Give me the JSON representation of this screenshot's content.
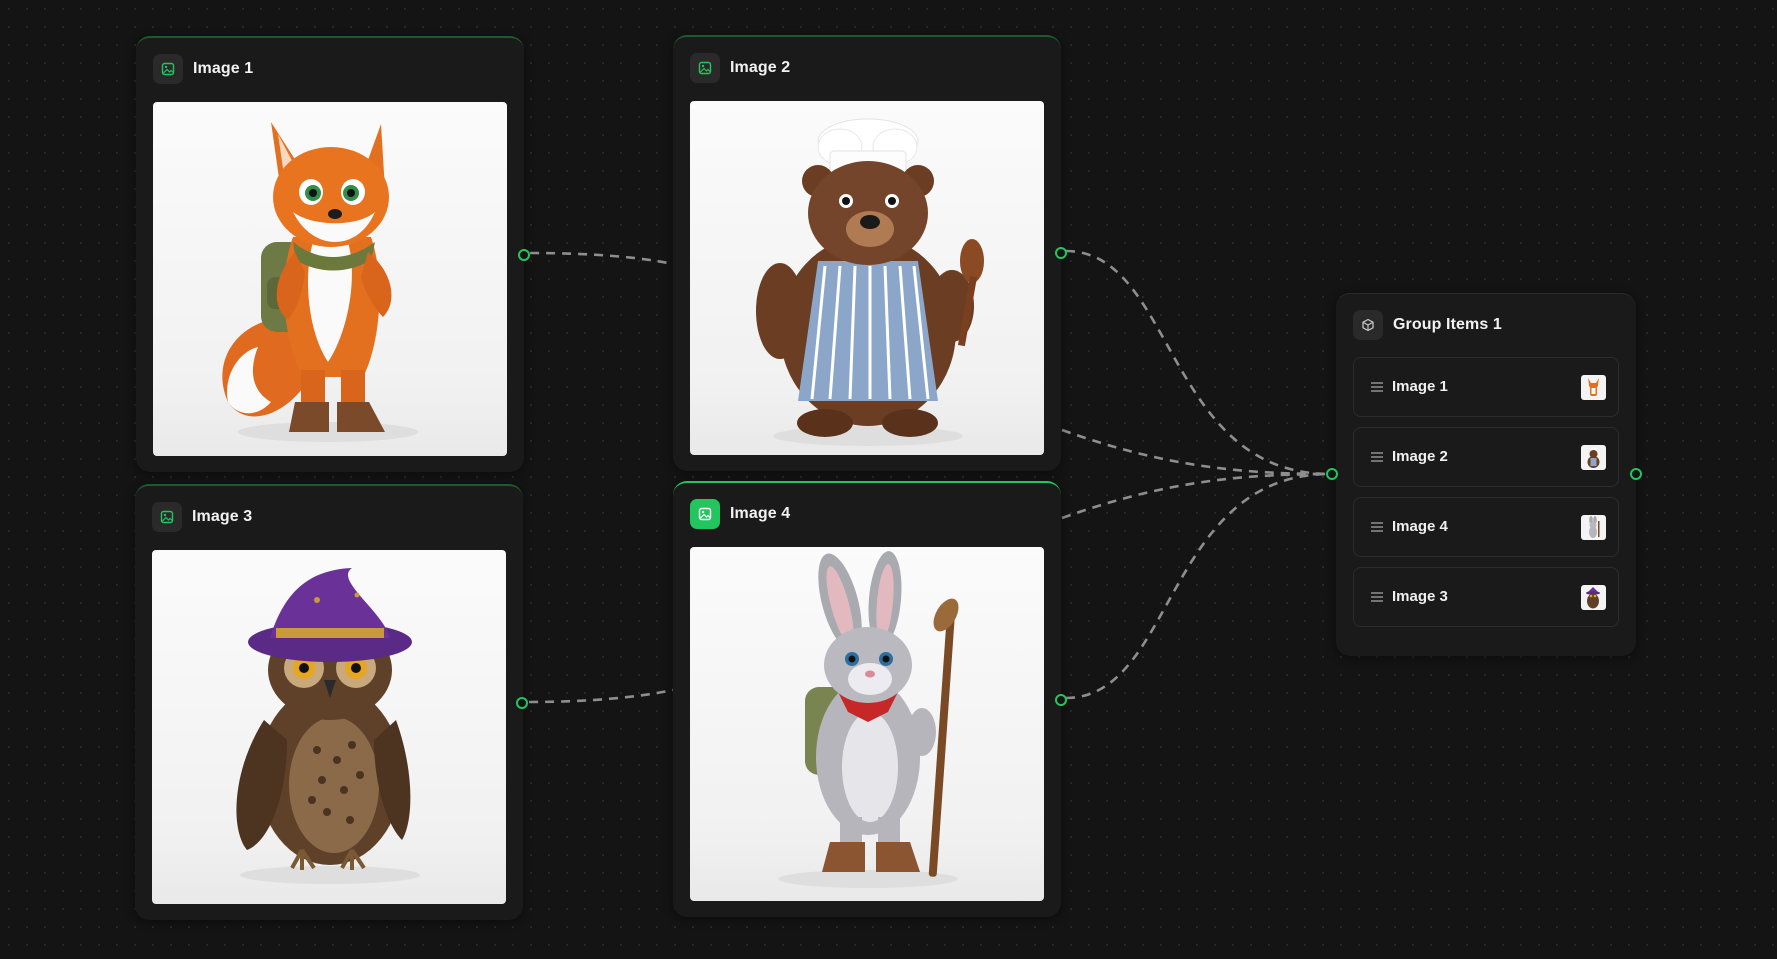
{
  "nodes": {
    "image1": {
      "title": "Image 1"
    },
    "image2": {
      "title": "Image 2"
    },
    "image3": {
      "title": "Image 3"
    },
    "image4": {
      "title": "Image 4"
    }
  },
  "group": {
    "title": "Group Items 1",
    "items": [
      {
        "label": "Image 1",
        "thumb": "fox"
      },
      {
        "label": "Image 2",
        "thumb": "bear"
      },
      {
        "label": "Image 4",
        "thumb": "rabbit"
      },
      {
        "label": "Image 3",
        "thumb": "owl"
      }
    ]
  },
  "icons": {
    "image_node": "image-icon",
    "group_node": "cube-icon",
    "row_handle": "drag-handle-icon"
  },
  "colors": {
    "accent": "#22c55e",
    "canvas": "#141414",
    "node": "#1a1a1a",
    "edge": "#8a8a8a"
  }
}
